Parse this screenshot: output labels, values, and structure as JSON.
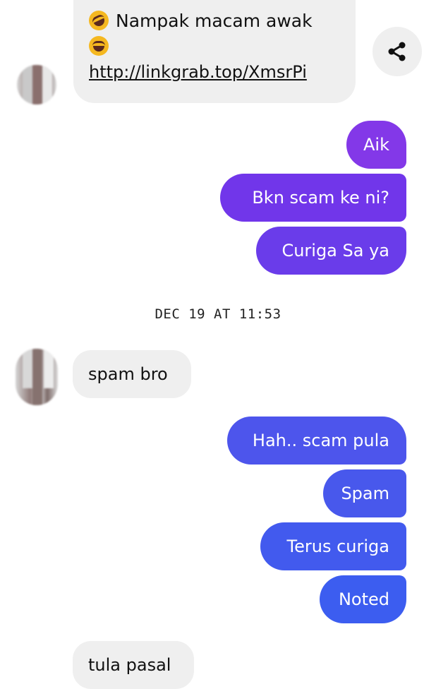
{
  "messages": {
    "incoming_1": {
      "line1": "Nampak macam awak",
      "link": "http://linkgrab.top/XmsrPi",
      "emoji1": "rolling-on-floor-laughing-emoji",
      "emoji2": "tears-of-joy-emoji"
    },
    "outgoing_1": [
      "Aik",
      "Bkn scam ke ni?",
      "Curiga Sa ya"
    ],
    "timestamp": "DEC 19 AT 11:53",
    "incoming_2": "spam bro",
    "outgoing_2": [
      "Hah.. scam pula",
      "Spam",
      "Terus curiga",
      "Noted"
    ],
    "incoming_3": "tula pasal"
  },
  "actions": {
    "share_icon": "share-icon"
  },
  "colors": {
    "incoming_bubble": "#efefef",
    "outgoing_purple": "#7b35e6",
    "outgoing_violet": "#6a3cea",
    "outgoing_blue": "#4a55ec",
    "outgoing_royal": "#3d5df0"
  }
}
